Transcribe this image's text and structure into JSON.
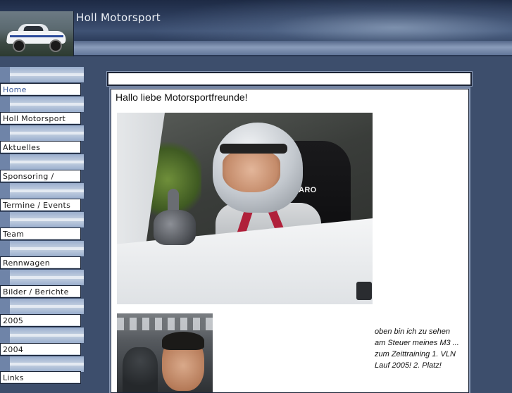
{
  "header": {
    "site_title": "Holl Motorsport"
  },
  "sidebar": {
    "items": [
      {
        "label": "Home"
      },
      {
        "label": "Holl Motorsport"
      },
      {
        "label": "Aktuelles"
      },
      {
        "label": "Sponsoring / Events"
      },
      {
        "label": "Termine / Events"
      },
      {
        "label": "Team"
      },
      {
        "label": "Rennwagen"
      },
      {
        "label": "Bilder / Berichte"
      },
      {
        "label": "2005"
      },
      {
        "label": "2004"
      },
      {
        "label": "Links"
      }
    ]
  },
  "main": {
    "greeting": "Hallo liebe Motorsportfreunde!",
    "photo_main": {
      "seat_brand": "RECARO"
    },
    "caption": "oben bin ich zu sehen am Steuer meines M3 ... zum Zeittraining 1. VLN Lauf 2005!   2. Platz!"
  },
  "colors": {
    "page_background": "#3d4e6c",
    "header_dark": "#1d2a44",
    "nav_active_text": "#3a5a9c"
  }
}
